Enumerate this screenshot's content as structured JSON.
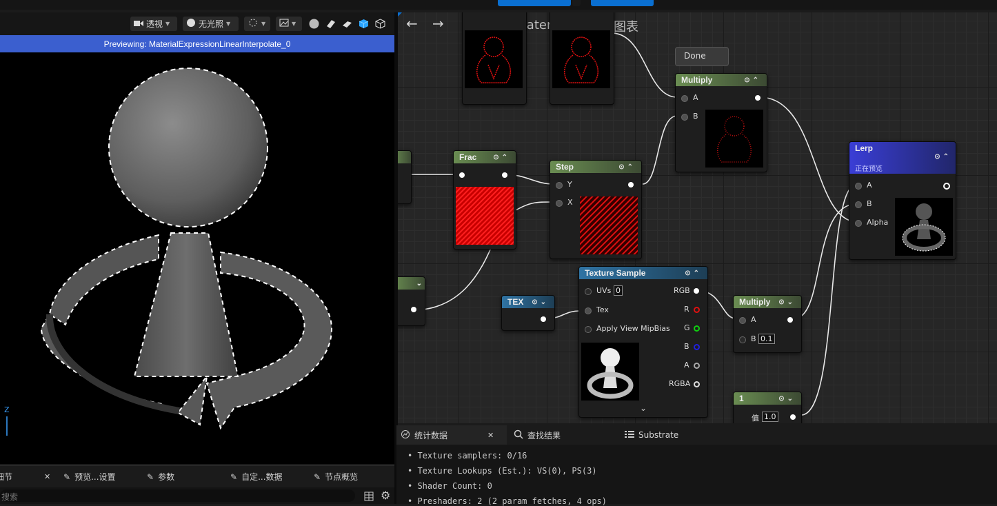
{
  "viewport": {
    "toolbar": {
      "perspective": "透视",
      "lighting": "无光照"
    },
    "preview_banner": "Previewing: MaterialExpressionLinearInterpolate_0",
    "axis_label": "Z"
  },
  "graph": {
    "breadcrumb_material": "NewMaterial1",
    "breadcrumb_sep": ">",
    "breadcrumb_graph": "材质图表",
    "done_label": "Done",
    "nodes": {
      "frac": {
        "title": "Frac"
      },
      "step": {
        "title": "Step",
        "pin_y": "Y",
        "pin_x": "X"
      },
      "multiply_top": {
        "title": "Multiply",
        "pin_a": "A",
        "pin_b": "B"
      },
      "lerp": {
        "title": "Lerp",
        "subtitle": "正在预览",
        "pin_a": "A",
        "pin_b": "B",
        "pin_alpha": "Alpha"
      },
      "texture_sample": {
        "title": "Texture Sample",
        "pin_uvs": "UVs",
        "uvs_value": "0",
        "pin_tex": "Tex",
        "pin_mip": "Apply View MipBias",
        "out_rgb": "RGB",
        "out_r": "R",
        "out_g": "G",
        "out_b": "B",
        "out_a": "A",
        "out_rgba": "RGBA"
      },
      "tex": {
        "title": "TEX"
      },
      "multiply_bottom": {
        "title": "Multiply",
        "pin_a": "A",
        "pin_b": "B",
        "b_value": "0.1"
      },
      "constant": {
        "title": "1",
        "label": "值",
        "value": "1.0"
      }
    }
  },
  "stats": {
    "tabs": [
      {
        "label": "统计数据"
      },
      {
        "label": "查找结果"
      },
      {
        "label": "Substrate"
      }
    ],
    "lines": [
      "Texture samplers: 0/16",
      "Texture Lookups (Est.): VS(0), PS(3)",
      "Shader Count: 0",
      "Preshaders: 2  (2 param fetches, 4 ops)"
    ]
  },
  "bottom_left": {
    "tabs": [
      {
        "label": "细节"
      },
      {
        "label": "预览...设置"
      },
      {
        "label": "参数"
      },
      {
        "label": "自定...数据"
      },
      {
        "label": "节点概览"
      }
    ],
    "search_placeholder": "搜索"
  },
  "colors": {
    "banner": "#3b5fcf",
    "accent_blue": "#0a6fd1",
    "node_header_green": "#6a8d52",
    "node_header_blue": "#2f73a3",
    "lerp_header": "#3a3ed6"
  }
}
